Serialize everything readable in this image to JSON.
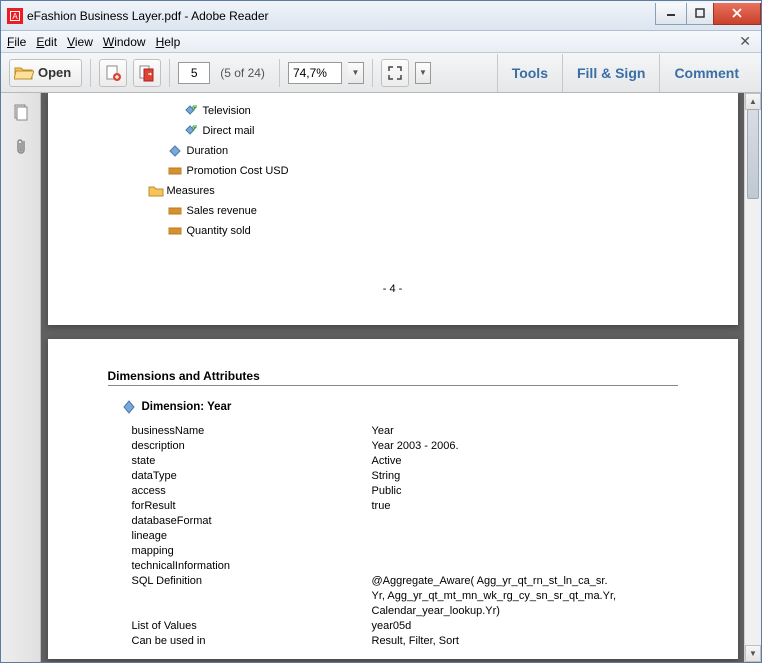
{
  "window": {
    "title": "eFashion Business Layer.pdf - Adobe Reader"
  },
  "menu": {
    "file": "File",
    "edit": "Edit",
    "view": "View",
    "window": "Window",
    "help": "Help"
  },
  "toolbar": {
    "open": "Open",
    "page_current": "5",
    "page_total": "(5 of 24)",
    "zoom": "74,7%",
    "tools": "Tools",
    "fillsign": "Fill & Sign",
    "comment": "Comment"
  },
  "page1": {
    "items": [
      {
        "indent": "ind1",
        "icon": "attr",
        "label": "Television"
      },
      {
        "indent": "ind1",
        "icon": "attr",
        "label": "Direct mail"
      },
      {
        "indent": "ind0b",
        "icon": "dim",
        "label": "Duration"
      },
      {
        "indent": "ind0c",
        "icon": "meas",
        "label": "Promotion Cost USD"
      },
      {
        "indent": "indF",
        "icon": "folder",
        "label": "Measures"
      },
      {
        "indent": "indM",
        "icon": "meas",
        "label": "Sales revenue"
      },
      {
        "indent": "indM",
        "icon": "meas",
        "label": "Quantity sold"
      }
    ],
    "page_number": "- 4 -"
  },
  "page2": {
    "section": "Dimensions and Attributes",
    "dim_heading": "Dimension: Year",
    "props": [
      {
        "k": "businessName",
        "v": "Year"
      },
      {
        "k": "description",
        "v": "Year 2003 - 2006."
      },
      {
        "k": "state",
        "v": "Active"
      },
      {
        "k": "dataType",
        "v": "String"
      },
      {
        "k": "access",
        "v": "Public"
      },
      {
        "k": "forResult",
        "v": "true"
      },
      {
        "k": "databaseFormat",
        "v": ""
      },
      {
        "k": "lineage",
        "v": ""
      },
      {
        "k": "mapping",
        "v": ""
      },
      {
        "k": "technicalInformation",
        "v": ""
      },
      {
        "k": "SQL Definition",
        "v": "@Aggregate_Aware( Agg_yr_qt_rn_st_ln_ca_sr.\nYr, Agg_yr_qt_mt_mn_wk_rg_cy_sn_sr_qt_ma.Yr,\nCalendar_year_lookup.Yr)"
      },
      {
        "k": "List of Values",
        "v": "year05d"
      },
      {
        "k": "Can be used in",
        "v": "Result, Filter, Sort"
      }
    ]
  }
}
